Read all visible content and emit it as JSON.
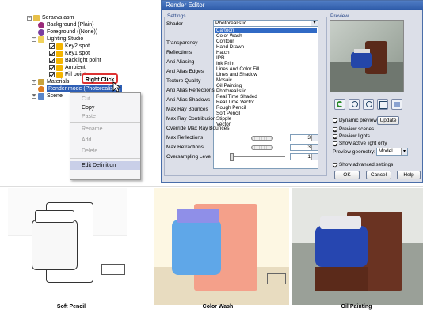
{
  "tree": {
    "items": [
      "Seracvs.asm",
      "Background (Plain)",
      "Foreground ((None))",
      "Lighting Studio",
      "Key2 spot",
      "Key1 spot",
      "Backlight point",
      "Ambient",
      "Fill point",
      "Materials",
      "Render mode (Photorealistic)",
      "Scene"
    ]
  },
  "callout": "Right Click",
  "context_menu": {
    "items": [
      "Cut",
      "Copy",
      "Paste",
      "Rename",
      "Add",
      "Delete",
      "Edit Definition"
    ]
  },
  "dialog": {
    "title": "Render Editor",
    "settings_label": "Settings",
    "preview_label": "Preview",
    "shader_label": "Shader",
    "shader_value": "Photorealistic",
    "shader_options": [
      "Cartoon",
      "Color Wash",
      "Contour",
      "Hand Drawn",
      "Hatch",
      "IPR",
      "Ink Print",
      "Lines And Color Fill",
      "Lines and Shadow",
      "Mosaic",
      "Oil Painting",
      "Photorealistic",
      "Real Time Shaded",
      "Real Time Vector",
      "Rough Pencil",
      "Soft Pencil",
      "Stipple",
      "Vector"
    ],
    "setting_labels": [
      "Transparency",
      "Reflections",
      "Anti Aliasing",
      "Anti Alias Edges",
      "Texture Quality",
      "Anti Alias Reflections",
      "Anti Alias Shadows",
      "Max Ray Bounces",
      "Max Ray Contribution",
      "Override Max Ray Bounces",
      "Max Reflections",
      "Max Refractions",
      "Oversampling Level"
    ],
    "max_reflections": "3",
    "max_refractions": "3",
    "oversampling": "1",
    "dynamic_preview": "Dynamic preview",
    "update": "Update",
    "preview_scenes": "Preview scenes",
    "preview_lights": "Preview lights",
    "show_active_light": "Show active light only",
    "preview_geometry_label": "Preview geometry:",
    "preview_geometry_value": "Model",
    "show_advanced": "Show advanced settings",
    "ok": "OK",
    "cancel": "Cancel",
    "help": "Help"
  },
  "captions": [
    "Soft Pencil",
    "Color Wash",
    "Oil Painting"
  ]
}
